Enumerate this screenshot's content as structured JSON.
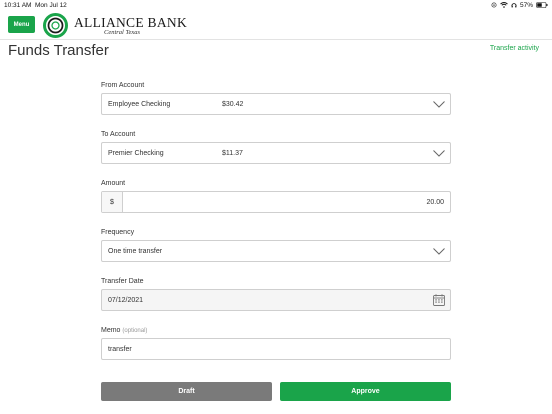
{
  "status_bar": {
    "time": "10:31 AM",
    "date": "Mon Jul 12",
    "battery": "57%"
  },
  "header": {
    "menu_label": "Menu",
    "bank_name": "ALLIANCE BANK",
    "bank_sub": "Central Texas",
    "brand_color": "#1aa44a",
    "logo_icon": "alliance-bank-logo"
  },
  "page": {
    "title": "Funds Transfer",
    "transfer_activity": "Transfer activity"
  },
  "form": {
    "from_account": {
      "label": "From Account",
      "name": "Employee Checking",
      "balance": "$30.42"
    },
    "to_account": {
      "label": "To Account",
      "name": "Premier Checking",
      "balance": "$11.37"
    },
    "amount": {
      "label": "Amount",
      "prefix": "$",
      "value": "20.00"
    },
    "frequency": {
      "label": "Frequency",
      "value": "One time transfer"
    },
    "transfer_date": {
      "label": "Transfer Date",
      "value": "07/12/2021"
    },
    "memo": {
      "label": "Memo",
      "optional": "(optional)",
      "value": "transfer"
    }
  },
  "actions": {
    "draft_label": "Draft",
    "approve_label": "Approve"
  }
}
